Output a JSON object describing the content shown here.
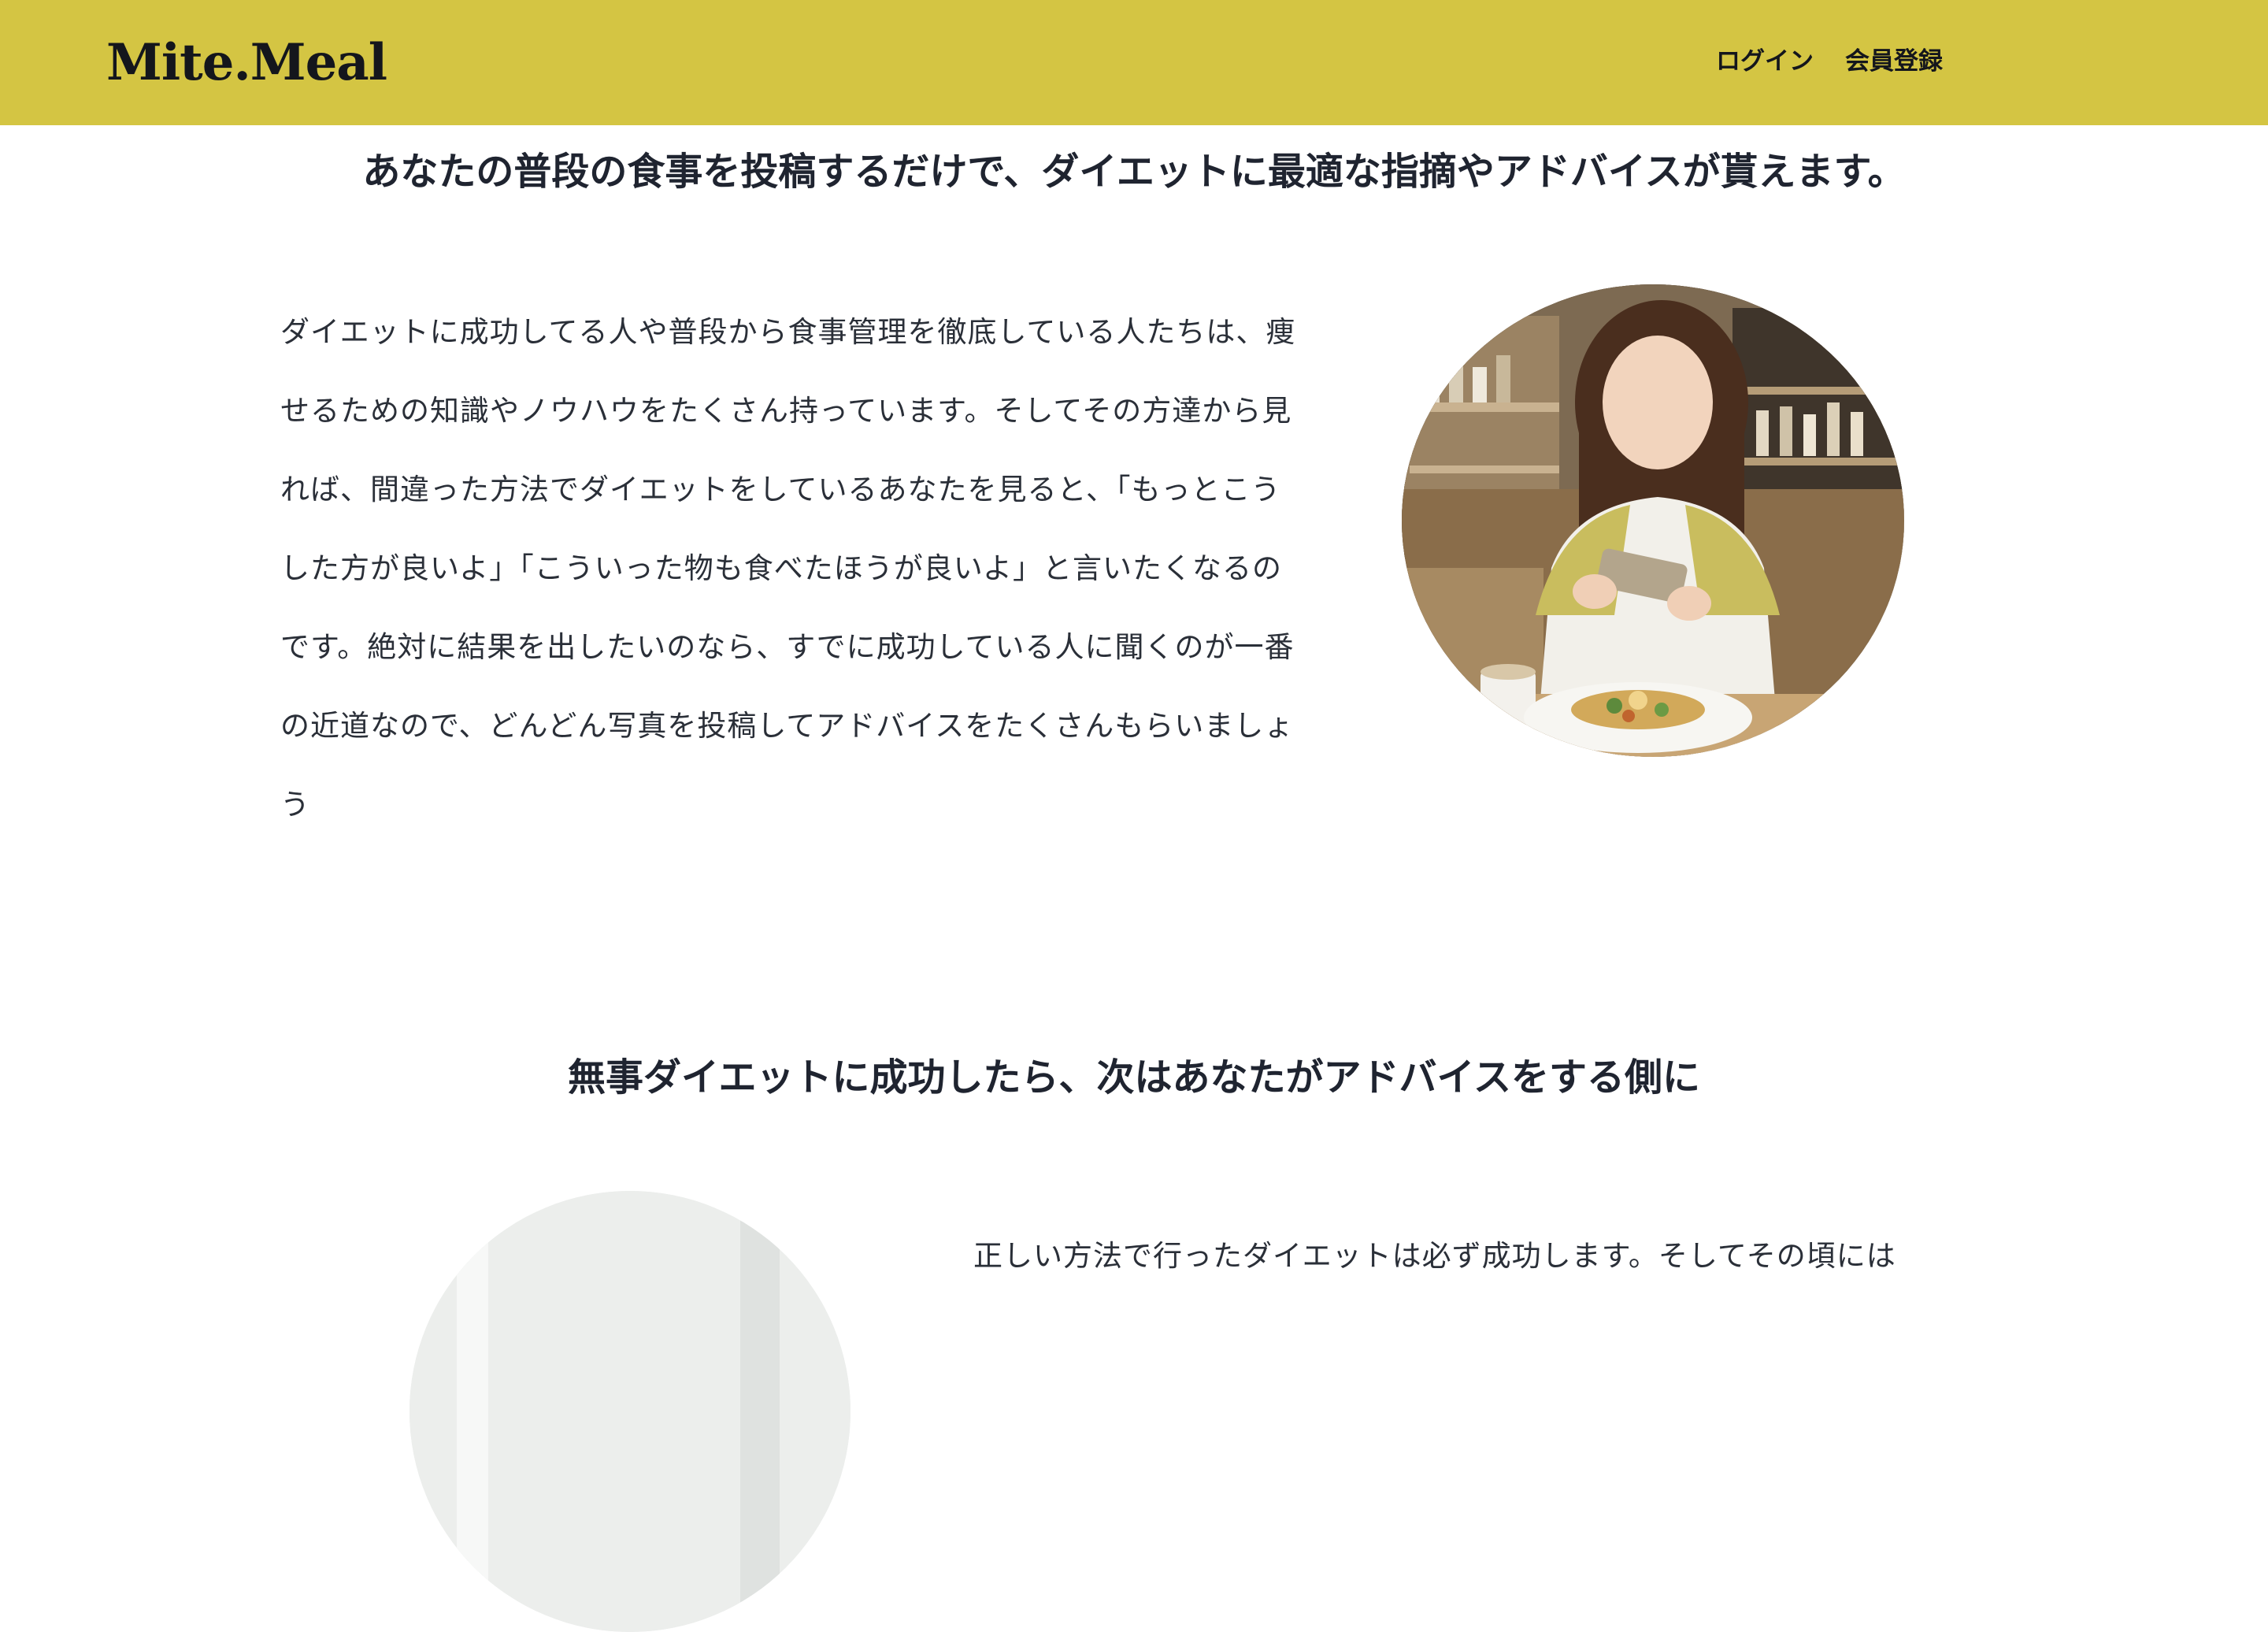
{
  "header": {
    "logo": "Mite.Meal",
    "nav": {
      "login": "ログイン",
      "signup": "会員登録"
    }
  },
  "section1": {
    "title": "あなたの普段の食事を投稿するだけで、ダイエットに最適な指摘やアドバイスが貰えます。",
    "body": "ダイエットに成功してる人や普段から食事管理を徹底している人たちは、痩せるための知識やノウハウをたくさん持っています。そしてその方達から見れば、間違った方法でダイエットをしているあなたを見ると、「もっとこうした方が良いよ」「こういった物も食べたほうが良いよ」と言いたくなるのです。絶対に結果を出したいのなら、すでに成功している人に聞くのが一番の近道なので、どんどん写真を投稿してアドバイスをたくさんもらいましょう"
  },
  "section2": {
    "title": "無事ダイエットに成功したら、次はあなたがアドバイスをする側に",
    "body": "正しい方法で行ったダイエットは必ず成功します。そしてその頃には"
  },
  "colors": {
    "header_bg": "#d4c543",
    "text": "#1f2430"
  }
}
